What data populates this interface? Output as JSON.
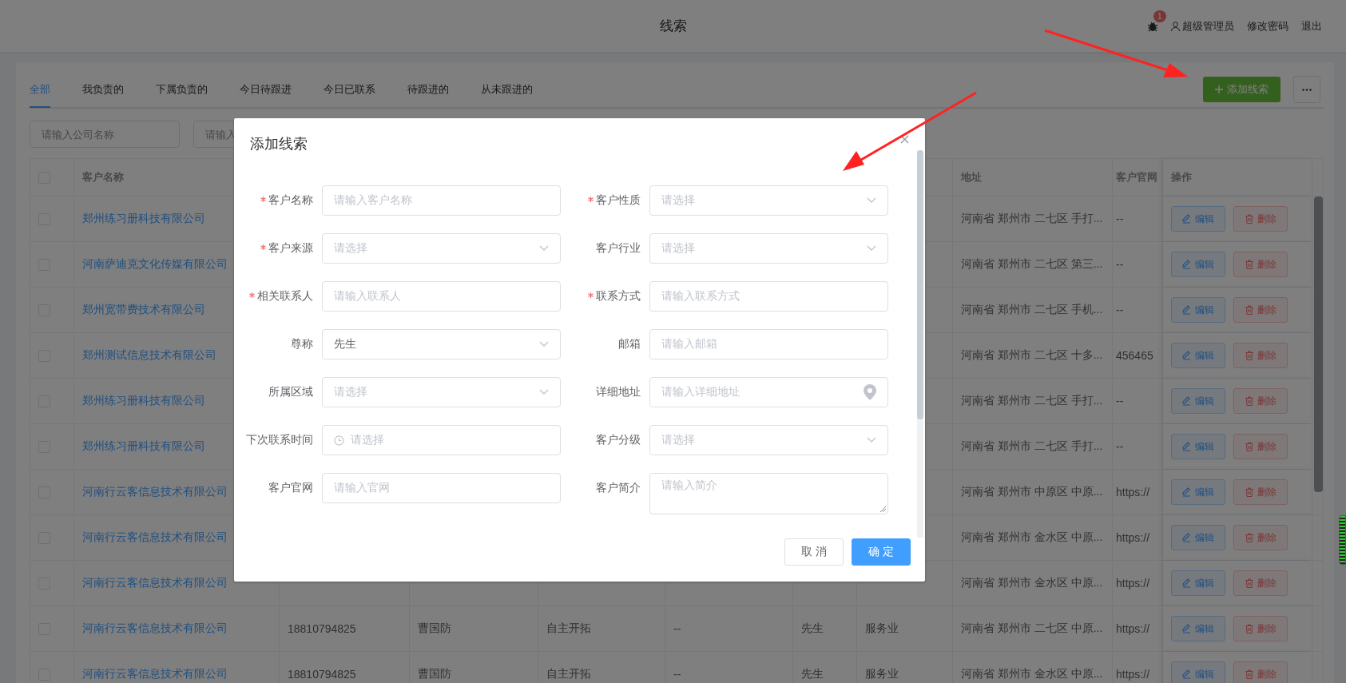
{
  "header": {
    "title": "线索",
    "notification_count": "1",
    "user": "超级管理员",
    "links": [
      "修改密码",
      "退出"
    ]
  },
  "tabs": [
    {
      "label": "全部",
      "selected": true
    },
    {
      "label": "我负责的",
      "selected": false
    },
    {
      "label": "下属负责的",
      "selected": false
    },
    {
      "label": "今日待跟进",
      "selected": false
    },
    {
      "label": "今日已联系",
      "selected": false
    },
    {
      "label": "待跟进的",
      "selected": false
    },
    {
      "label": "从未跟进的",
      "selected": false
    }
  ],
  "add_button": "添加线索",
  "filters": [
    {
      "placeholder": "请输入公司名称"
    },
    {
      "placeholder": "请输入"
    }
  ],
  "table": {
    "header": {
      "checked": false,
      "name": "客户名称",
      "address": "地址",
      "website": "客户官网",
      "actions": "操作"
    },
    "rows": [
      {
        "checked": false,
        "name": "郑州练习册科技有限公司",
        "address": "河南省 郑州市 二七区 手打...",
        "website": "--",
        "edit": "编辑",
        "delete": "删除"
      },
      {
        "checked": false,
        "name": "河南萨迪克文化传媒有限公司",
        "address": "河南省 郑州市 二七区 第三...",
        "website": "--",
        "edit": "编辑",
        "delete": "删除"
      },
      {
        "checked": false,
        "name": "郑州宽带费技术有限公司",
        "address": "河南省 郑州市 二七区 手机...",
        "website": "--",
        "edit": "编辑",
        "delete": "删除"
      },
      {
        "checked": false,
        "name": "郑州测试信息技术有限公司",
        "address": "河南省 郑州市 二七区 十多...",
        "website": "456465",
        "edit": "编辑",
        "delete": "删除"
      },
      {
        "checked": false,
        "name": "郑州练习册科技有限公司",
        "address": "河南省 郑州市 二七区 手打...",
        "website": "--",
        "edit": "编辑",
        "delete": "删除"
      },
      {
        "checked": false,
        "name": "郑州练习册科技有限公司",
        "address": "河南省 郑州市 二七区 手打...",
        "website": "--",
        "edit": "编辑",
        "delete": "删除"
      },
      {
        "checked": false,
        "name": "河南行云客信息技术有限公司",
        "address": "河南省 郑州市 中原区 中原...",
        "website": "https://",
        "edit": "编辑",
        "delete": "删除"
      },
      {
        "checked": false,
        "name": "河南行云客信息技术有限公司",
        "address": "河南省 郑州市 金水区 中原...",
        "website": "https://",
        "edit": "编辑",
        "delete": "删除"
      },
      {
        "checked": false,
        "name": "河南行云客信息技术有限公司",
        "address": "河南省 郑州市 金水区 中原...",
        "website": "https://",
        "edit": "编辑",
        "delete": "删除"
      },
      {
        "checked": false,
        "name": "河南行云客信息技术有限公司",
        "middle": [
          "18810794825",
          "曹国防",
          "自主开拓",
          "--",
          "先生",
          "服务业"
        ],
        "address": "河南省 郑州市 二七区 中原...",
        "website": "https://",
        "edit": "编辑",
        "delete": "删除"
      },
      {
        "checked": false,
        "name": "河南行云客信息技术有限公司",
        "middle": [
          "18810794825",
          "曹国防",
          "自主开拓",
          "--",
          "先生",
          "服务业"
        ],
        "address": "河南省 郑州市 金水区 中原...",
        "website": "https://",
        "edit": "编辑",
        "delete": "删除"
      }
    ]
  },
  "dialog": {
    "title": "添加线索",
    "fields": [
      {
        "label": "客户名称",
        "required": true,
        "kind": "input",
        "placeholder": "请输入客户名称"
      },
      {
        "label": "客户性质",
        "required": true,
        "kind": "select",
        "placeholder": "请选择"
      },
      {
        "label": "客户来源",
        "required": true,
        "kind": "select",
        "placeholder": "请选择"
      },
      {
        "label": "客户行业",
        "required": false,
        "kind": "select",
        "placeholder": "请选择"
      },
      {
        "label": "相关联系人",
        "required": true,
        "kind": "input",
        "placeholder": "请输入联系人"
      },
      {
        "label": "联系方式",
        "required": true,
        "kind": "input",
        "placeholder": "请输入联系方式"
      },
      {
        "label": "尊称",
        "required": false,
        "kind": "select",
        "value": "先生"
      },
      {
        "label": "邮箱",
        "required": false,
        "kind": "input",
        "placeholder": "请输入邮箱"
      },
      {
        "label": "所属区域",
        "required": false,
        "kind": "select",
        "placeholder": "请选择"
      },
      {
        "label": "详细地址",
        "required": false,
        "kind": "location",
        "placeholder": "请输入详细地址"
      },
      {
        "label": "下次联系时间",
        "required": false,
        "kind": "date",
        "placeholder": "请选择"
      },
      {
        "label": "客户分级",
        "required": false,
        "kind": "select",
        "placeholder": "请选择"
      },
      {
        "label": "客户官网",
        "required": false,
        "kind": "input",
        "placeholder": "请输入官网"
      },
      {
        "label": "客户简介",
        "required": false,
        "kind": "textarea",
        "placeholder": "请输入简介"
      }
    ],
    "buttons": [
      {
        "label": "取 消",
        "kind": "default"
      },
      {
        "label": "确 定",
        "kind": "primary"
      }
    ]
  }
}
